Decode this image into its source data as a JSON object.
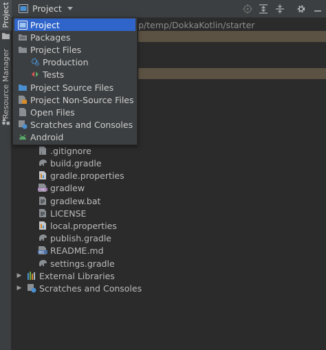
{
  "colors": {
    "selection": "#2f65ca",
    "panel": "#3c3f41",
    "editor": "#2b2b2b",
    "highlight_row": "#5c5243",
    "folder_blue": "#4a8fcf",
    "gradle_grey": "#8a8f94"
  },
  "side_strip": {
    "project_tab": "Project",
    "resource_manager_tab": "Resource Manager"
  },
  "header": {
    "view_label": "Project",
    "icons": [
      "locate-icon",
      "expand-all-icon",
      "collapse-all-icon",
      "settings-gear-icon",
      "hide-panel-icon"
    ]
  },
  "path_text": "p/temp/DokkaKotlin/starter",
  "dropdown": {
    "items": [
      {
        "label": "Project",
        "icon": "project-view-icon",
        "selected": true
      },
      {
        "label": "Packages",
        "icon": "packages-folder-icon"
      },
      {
        "label": "Project Files",
        "icon": "folder-icon"
      },
      {
        "label": "Production",
        "icon": "production-gear-icon",
        "sub": true
      },
      {
        "label": "Tests",
        "icon": "tests-icon",
        "sub": true
      },
      {
        "label": "Project Source Files",
        "icon": "folder-icon"
      },
      {
        "label": "Project Non-Source Files",
        "icon": "non-source-files-icon"
      },
      {
        "label": "Open Files",
        "icon": "open-files-icon"
      },
      {
        "label": "Scratches and Consoles",
        "icon": "scratches-icon"
      },
      {
        "label": "Android",
        "icon": "android-icon"
      }
    ]
  },
  "tree": {
    "files": [
      {
        "name": ".gitignore",
        "icon": "gitignore-file-icon"
      },
      {
        "name": "build.gradle",
        "icon": "gradle-elephant-icon"
      },
      {
        "name": "gradle.properties",
        "icon": "properties-file-icon"
      },
      {
        "name": "gradlew",
        "icon": "shell-file-icon"
      },
      {
        "name": "gradlew.bat",
        "icon": "text-file-icon"
      },
      {
        "name": "LICENSE",
        "icon": "text-file-icon"
      },
      {
        "name": "local.properties",
        "icon": "properties-file-icon"
      },
      {
        "name": "publish.gradle",
        "icon": "gradle-elephant-icon"
      },
      {
        "name": "README.md",
        "icon": "markdown-file-icon"
      },
      {
        "name": "settings.gradle",
        "icon": "gradle-elephant-icon"
      }
    ],
    "external_libraries": "External Libraries",
    "scratches": "Scratches and Consoles"
  }
}
